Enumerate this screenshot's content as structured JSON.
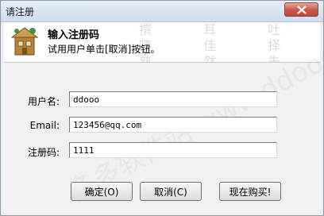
{
  "window": {
    "title": "请注册"
  },
  "header": {
    "title": "输入注册码",
    "subtitle": "试用用户单击[取消]按钮。",
    "watermark": "撰 耳 吐 咦 佳 择 熟 然 朱 陵 衣"
  },
  "form": {
    "username": {
      "label": "用户名:",
      "value": "ddooo"
    },
    "email": {
      "label": "Email:",
      "value": "123456@qq.com"
    },
    "regcode": {
      "label": "注册码:",
      "value": "1111"
    }
  },
  "buttons": {
    "ok": "确定(O)",
    "cancel": "取消(C)",
    "buy": "现在购买!"
  },
  "watermark": {
    "diagonal": "多多软件站 www.ddooo.com"
  },
  "colors": {
    "close_button": "#c7584a",
    "window_bg": "#f0f0f0",
    "header_bg": "#ffffff"
  }
}
